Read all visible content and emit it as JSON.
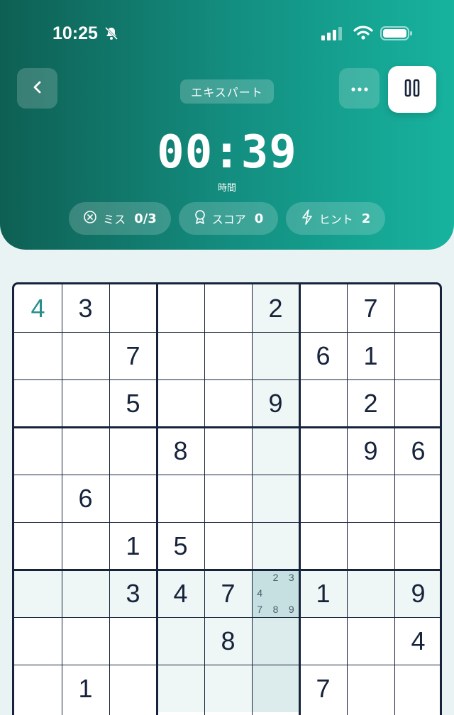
{
  "status_bar": {
    "time": "10:25"
  },
  "header": {
    "difficulty": "エキスパート",
    "timer": "00:39",
    "timer_label": "時間",
    "stats": {
      "mistakes_label": "ミス",
      "mistakes_value": "0/3",
      "score_label": "スコア",
      "score_value": "0",
      "hints_label": "ヒント",
      "hints_value": "2"
    }
  },
  "board": {
    "rows": [
      [
        "4",
        "3",
        "",
        "",
        "",
        "2",
        "",
        "7",
        ""
      ],
      [
        "",
        "",
        "7",
        "",
        "",
        "",
        "6",
        "1",
        ""
      ],
      [
        "",
        "",
        "5",
        "",
        "",
        "9",
        "",
        "2",
        ""
      ],
      [
        "",
        "",
        "",
        "8",
        "",
        "",
        "",
        "9",
        "6"
      ],
      [
        "",
        "6",
        "",
        "",
        "",
        "",
        "",
        "",
        ""
      ],
      [
        "",
        "",
        "1",
        "5",
        "",
        "",
        "",
        "",
        ""
      ],
      [
        "",
        "",
        "3",
        "4",
        "7",
        "",
        "1",
        "",
        "9"
      ],
      [
        "",
        "",
        "",
        "",
        "8",
        "",
        "",
        "",
        "4"
      ],
      [
        "",
        "1",
        "",
        "",
        "",
        "",
        "7",
        "",
        ""
      ]
    ],
    "user_entries": [
      [
        0,
        0
      ]
    ],
    "selected": [
      6,
      5
    ],
    "notes": {
      "6,5": [
        "",
        "2",
        "3",
        "4",
        "",
        "",
        "7",
        "8",
        "9"
      ]
    }
  }
}
